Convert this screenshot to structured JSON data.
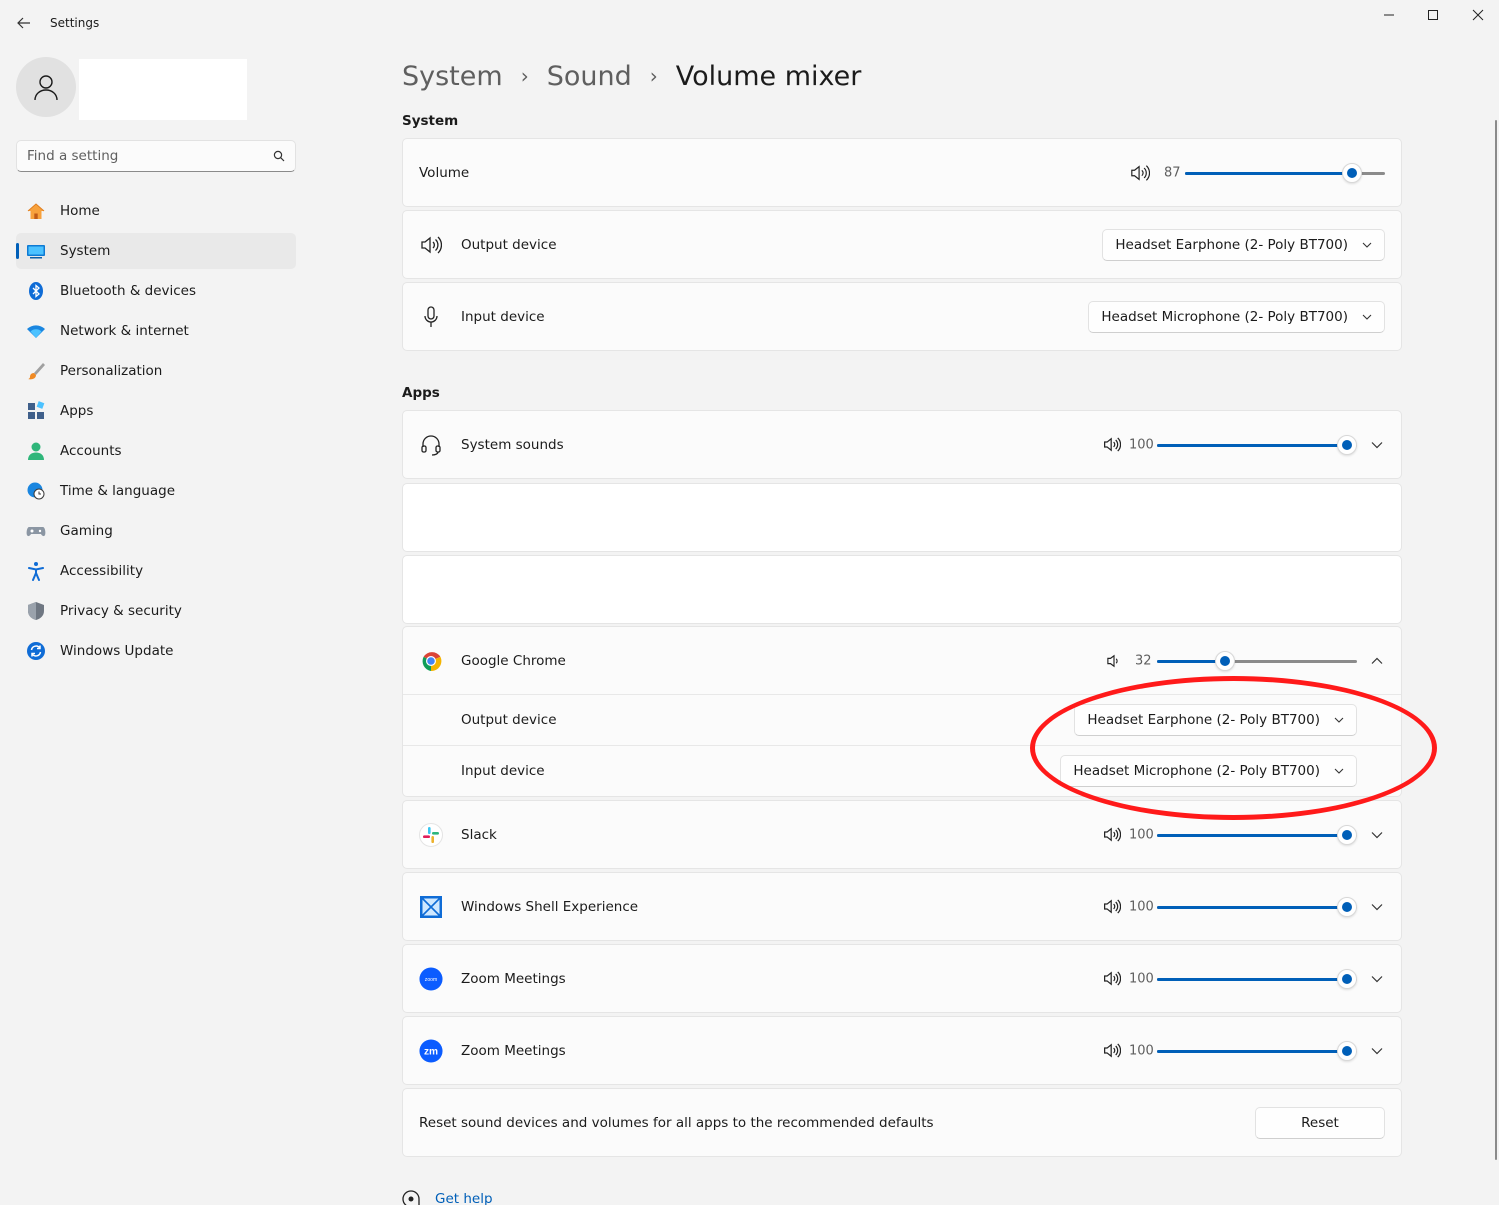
{
  "window": {
    "title": "Settings"
  },
  "search": {
    "placeholder": "Find a setting"
  },
  "nav": [
    {
      "label": "Home",
      "icon": "home-icon"
    },
    {
      "label": "System",
      "icon": "system-icon",
      "selected": true
    },
    {
      "label": "Bluetooth & devices",
      "icon": "bluetooth-icon"
    },
    {
      "label": "Network & internet",
      "icon": "wifi-icon"
    },
    {
      "label": "Personalization",
      "icon": "brush-icon"
    },
    {
      "label": "Apps",
      "icon": "apps-icon"
    },
    {
      "label": "Accounts",
      "icon": "accounts-icon"
    },
    {
      "label": "Time & language",
      "icon": "globe-clock-icon"
    },
    {
      "label": "Gaming",
      "icon": "gamepad-icon"
    },
    {
      "label": "Accessibility",
      "icon": "accessibility-icon"
    },
    {
      "label": "Privacy & security",
      "icon": "shield-icon"
    },
    {
      "label": "Windows Update",
      "icon": "update-icon"
    }
  ],
  "breadcrumb": {
    "parent1": "System",
    "parent2": "Sound",
    "current": "Volume mixer",
    "separator": "›"
  },
  "system_section": {
    "title": "System",
    "volume": {
      "label": "Volume",
      "value": 87
    },
    "output": {
      "label": "Output device",
      "selected": "Headset Earphone (2- Poly BT700)"
    },
    "input": {
      "label": "Input device",
      "selected": "Headset Microphone (2- Poly BT700)"
    }
  },
  "apps_section": {
    "title": "Apps",
    "apps": [
      {
        "name": "System sounds",
        "icon": "headset-icon",
        "volume": 100
      },
      {
        "name": "Google Chrome",
        "icon": "chrome-icon",
        "volume": 32,
        "expanded": true,
        "output_label": "Output device",
        "output_value": "Headset Earphone (2- Poly BT700)",
        "input_label": "Input device",
        "input_value": "Headset Microphone (2- Poly BT700)"
      },
      {
        "name": "Slack",
        "icon": "slack-icon",
        "volume": 100
      },
      {
        "name": "Windows Shell Experience",
        "icon": "windows-shell-icon",
        "volume": 100
      },
      {
        "name": "Zoom Meetings",
        "icon": "zoom-icon",
        "volume": 100
      },
      {
        "name": "Zoom Meetings",
        "icon": "zoom-zm-icon",
        "volume": 100
      }
    ]
  },
  "zoom_logo_text": {
    "small": "zoom",
    "zm": "zm"
  },
  "reset": {
    "text": "Reset sound devices and volumes for all apps to the recommended defaults",
    "button": "Reset"
  },
  "help": {
    "label": "Get help"
  },
  "colors": {
    "accent": "#005fb8",
    "annotation": "#ff1a1a",
    "background": "#f3f3f3"
  }
}
